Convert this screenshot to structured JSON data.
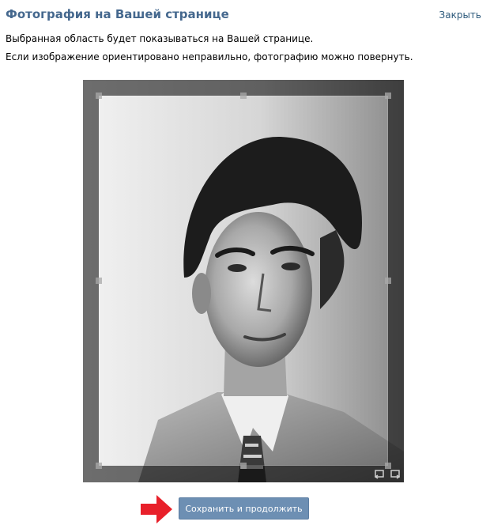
{
  "header": {
    "title": "Фотография на Вашей странице",
    "close_label": "Закрыть"
  },
  "description": {
    "line1": "Выбранная область будет показываться на Вашей странице.",
    "line2": "Если изображение ориентировано неправильно, фотографию можно повернуть."
  },
  "cropper": {
    "photo": "black-and-white-portrait-photo",
    "rotate_left_icon": "rotate-left-icon",
    "rotate_right_icon": "rotate-right-icon"
  },
  "footer": {
    "save_label": "Сохранить и продолжить",
    "arrow_icon": "red-arrow-right-icon"
  },
  "colors": {
    "title": "#45688e",
    "link": "#2b587a",
    "button": "#6d8fb3",
    "arrow": "#e8202a"
  }
}
